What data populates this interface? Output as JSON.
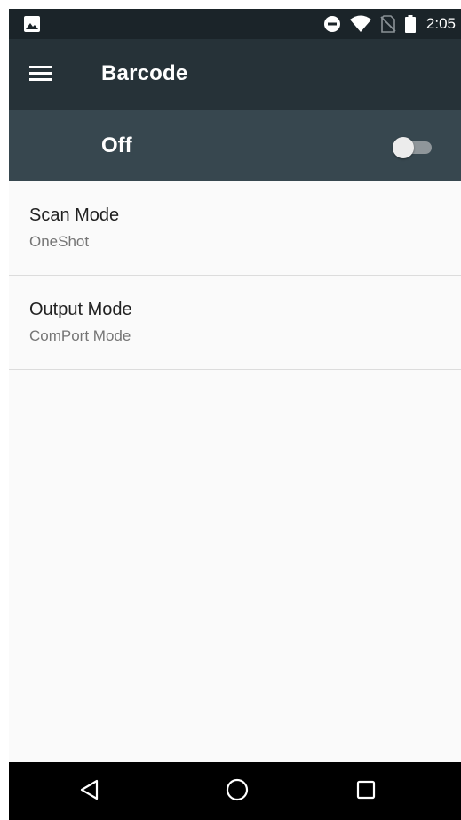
{
  "status_bar": {
    "time": "2:05",
    "left_icon": "image-notification-icon",
    "icons": [
      "do-not-disturb-icon",
      "wifi-icon",
      "no-sim-icon",
      "battery-icon"
    ]
  },
  "app_bar": {
    "title": "Barcode",
    "menu_icon": "hamburger-menu-icon"
  },
  "master_switch": {
    "label": "Off",
    "checked": false
  },
  "settings": [
    {
      "title": "Scan Mode",
      "summary": "OneShot"
    },
    {
      "title": "Output Mode",
      "summary": "ComPort Mode"
    }
  ],
  "nav_bar": {
    "back_icon": "back-triangle-icon",
    "home_icon": "home-circle-icon",
    "recents_icon": "recents-square-icon"
  },
  "colors": {
    "status_bar": "#1b2429",
    "app_bar": "#263238",
    "switch_bar": "#37474f",
    "background": "#fafafa",
    "nav_bar": "#000000"
  }
}
